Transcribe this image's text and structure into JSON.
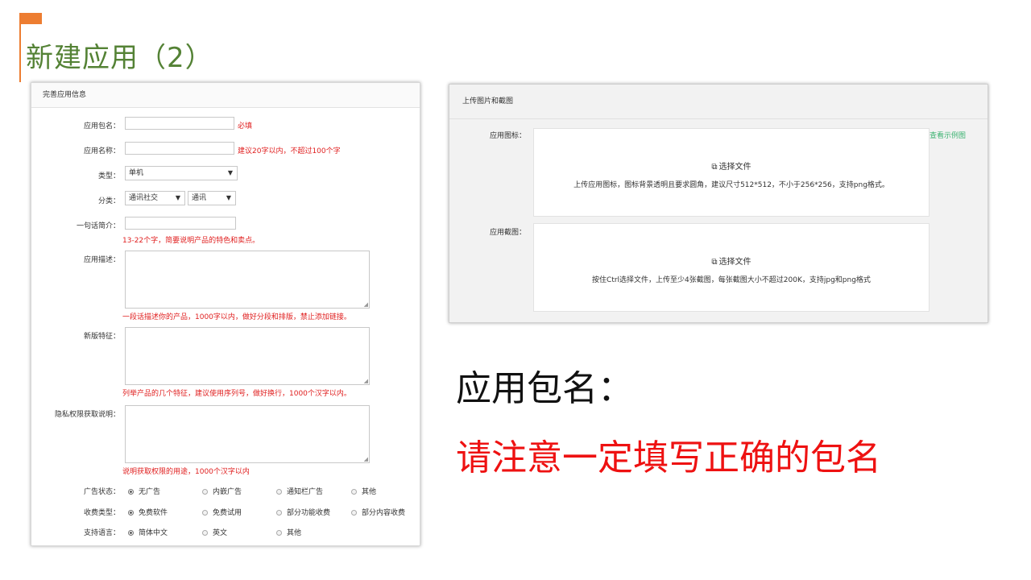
{
  "slide": {
    "title": "新建应用（2）",
    "heading": "应用包名：",
    "note": "请注意一定填写正确的包名"
  },
  "form": {
    "header": "完善应用信息",
    "package_label": "应用包名：",
    "package_hint": "必填",
    "name_label": "应用名称：",
    "name_hint": "建议20字以内，不超过100个字",
    "type_label": "类型：",
    "type_value": "单机",
    "category_label": "分类：",
    "category_value_1": "通讯社交",
    "category_value_2": "通讯",
    "intro_label": "一句话简介：",
    "intro_hint": "13-22个字，简要说明产品的特色和卖点。",
    "desc_label": "应用描述：",
    "desc_hint": "一段话描述你的产品，1000字以内，做好分段和排版，禁止添加链接。",
    "features_label": "新版特征：",
    "features_hint": "列举产品的几个特征，建议使用序列号，做好换行，1000个汉字以内。",
    "privacy_label": "隐私权限获取说明：",
    "privacy_hint": "说明获取权限的用途，1000个汉字以内",
    "ads_label": "广告状态：",
    "ads_options": [
      "无广告",
      "内嵌广告",
      "通知栏广告",
      "其他"
    ],
    "fee_label": "收费类型：",
    "fee_options": [
      "免费软件",
      "免费试用",
      "部分功能收费",
      "部分内容收费"
    ],
    "lang_label": "支持语言：",
    "lang_options": [
      "简体中文",
      "英文",
      "其他"
    ]
  },
  "upload": {
    "header": "上传图片和截图",
    "icon_label": "应用图标：",
    "example_link": "查看示例图",
    "choose_file": "选择文件",
    "icon_desc": "上传应用图标，图标背景透明且要求圆角，建议尺寸512*512，不小于256*256，支持png格式。",
    "screenshot_label": "应用截图：",
    "screenshot_desc": "按住Ctrl选择文件，上传至少4张截图，每张截图大小不超过200K，支持jpg和png格式"
  },
  "colors": {
    "accent": "#ed7d31",
    "title_green": "#548235",
    "hint_red": "#e02020",
    "note_red": "#ee1111",
    "link_green": "#3cb371"
  }
}
